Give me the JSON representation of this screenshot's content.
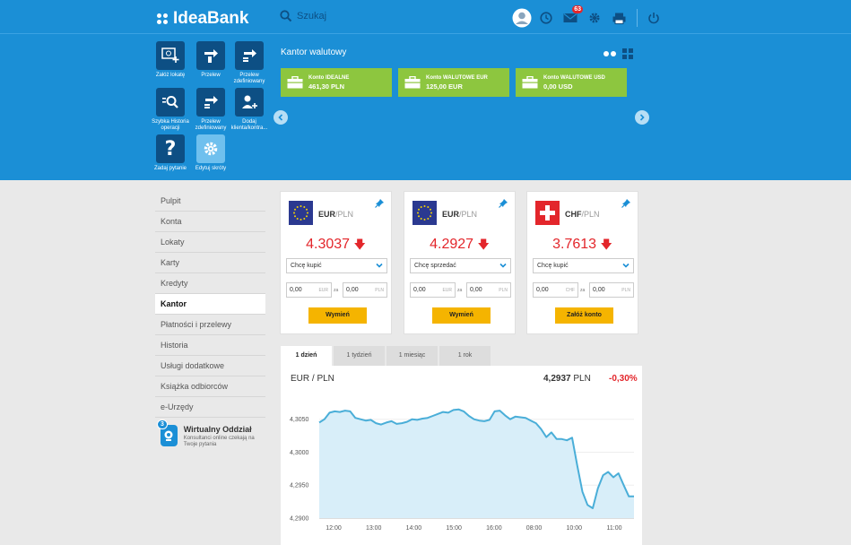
{
  "header": {
    "logo_text": "IdeaBank",
    "search_placeholder": "Szukaj",
    "notification_count": "63"
  },
  "shortcuts": [
    {
      "label": "Załóż lokatę"
    },
    {
      "label": "Przelew"
    },
    {
      "label": "Przelew zdefiniowany"
    },
    {
      "label": "Szybka Historia operacji"
    },
    {
      "label": "Przelew zdefiniowany"
    },
    {
      "label": "Dodaj klienta/kontra..."
    },
    {
      "label": "Zadaj pytanie"
    },
    {
      "label": "Edytuj skróty"
    }
  ],
  "exchange": {
    "section_title": "Kantor walutowy",
    "accounts": [
      {
        "name": "Konto IDEALNE",
        "balance": "461,30 PLN"
      },
      {
        "name": "Konto WALUTOWE EUR",
        "balance": "125,00 EUR"
      },
      {
        "name": "Konto WALUTOWE USD",
        "balance": "0,00 USD"
      }
    ]
  },
  "sidebar": {
    "items": [
      {
        "label": "Pulpit"
      },
      {
        "label": "Konta"
      },
      {
        "label": "Lokaty"
      },
      {
        "label": "Karty"
      },
      {
        "label": "Kredyty"
      },
      {
        "label": "Kantor"
      },
      {
        "label": "Płatności i przelewy"
      },
      {
        "label": "Historia"
      },
      {
        "label": "Usługi dodatkowe"
      },
      {
        "label": "Książka odbiorców"
      },
      {
        "label": "e-Urzędy"
      }
    ],
    "active_index": 5,
    "virtual_branch": {
      "badge": "3",
      "title": "Wirtualny Oddział",
      "subtitle": "Konsultanci online czekają na Twoje pytania"
    }
  },
  "cards": [
    {
      "base": "EUR",
      "quote": "/PLN",
      "flag": "eu",
      "rate": "4.3037",
      "action": "Chcę kupić",
      "amount_from": "0,00",
      "unit_from": "EUR",
      "sep": "za",
      "amount_to": "0,00",
      "unit_to": "PLN",
      "button": "Wymień"
    },
    {
      "base": "EUR",
      "quote": "/PLN",
      "flag": "eu",
      "rate": "4.2927",
      "action": "Chcę sprzedać",
      "amount_from": "0,00",
      "unit_from": "EUR",
      "sep": "za",
      "amount_to": "0,00",
      "unit_to": "PLN",
      "button": "Wymień"
    },
    {
      "base": "CHF",
      "quote": "/PLN",
      "flag": "ch",
      "rate": "3.7613",
      "action": "Chcę kupić",
      "amount_from": "0,00",
      "unit_from": "CHF",
      "sep": "za",
      "amount_to": "0,00",
      "unit_to": "PLN",
      "button": "Załóż konto"
    }
  ],
  "tabs": [
    {
      "label": "1 dzień"
    },
    {
      "label": "1 tydzień"
    },
    {
      "label": "1 miesiąc"
    },
    {
      "label": "1 rok"
    }
  ],
  "active_tab": 0,
  "chart_header": {
    "title": "EUR / PLN",
    "value": "4,2937",
    "unit": "PLN",
    "change": "-0,30%"
  },
  "colors": {
    "brand_blue": "#1b8fd6",
    "dark_blue": "#0d4f84",
    "account_green": "#8dc63f",
    "down_red": "#e3262b",
    "button_yellow": "#f5b400",
    "chart_line": "#4aaed8",
    "chart_fill": "#d8eef9"
  },
  "chart_data": {
    "type": "area",
    "title": "EUR / PLN",
    "x_ticks": [
      "12:00",
      "13:00",
      "14:00",
      "15:00",
      "16:00",
      "08:00",
      "10:00",
      "11:00"
    ],
    "y_ticks": [
      "4,3050",
      "4,3000",
      "4,2950",
      "4,2900"
    ],
    "ylim": [
      4.29,
      4.307
    ],
    "series": [
      {
        "values": [
          4.3045,
          4.305,
          4.306,
          4.3062,
          4.3061,
          4.3063,
          4.3062,
          4.3052,
          4.305,
          4.3048,
          4.3049,
          4.3044,
          4.3042,
          4.3045,
          4.3047,
          4.3043,
          4.3044,
          4.3046,
          4.305,
          4.3049,
          4.3051,
          4.3052,
          4.3055,
          4.3058,
          4.3061,
          4.306,
          4.3064,
          4.3065,
          4.3062,
          4.3055,
          4.305,
          4.3048,
          4.3047,
          4.3049,
          4.3062,
          4.3063,
          4.3056,
          4.305,
          4.3054,
          4.3053,
          4.3052,
          4.3048,
          4.3044,
          4.3035,
          4.3023,
          4.303,
          4.302,
          4.302,
          4.3018,
          4.3022,
          4.298,
          4.294,
          4.292,
          4.2915,
          4.2945,
          4.2965,
          4.297,
          4.2962,
          4.2968,
          4.295,
          4.2933,
          4.2933
        ]
      }
    ]
  }
}
